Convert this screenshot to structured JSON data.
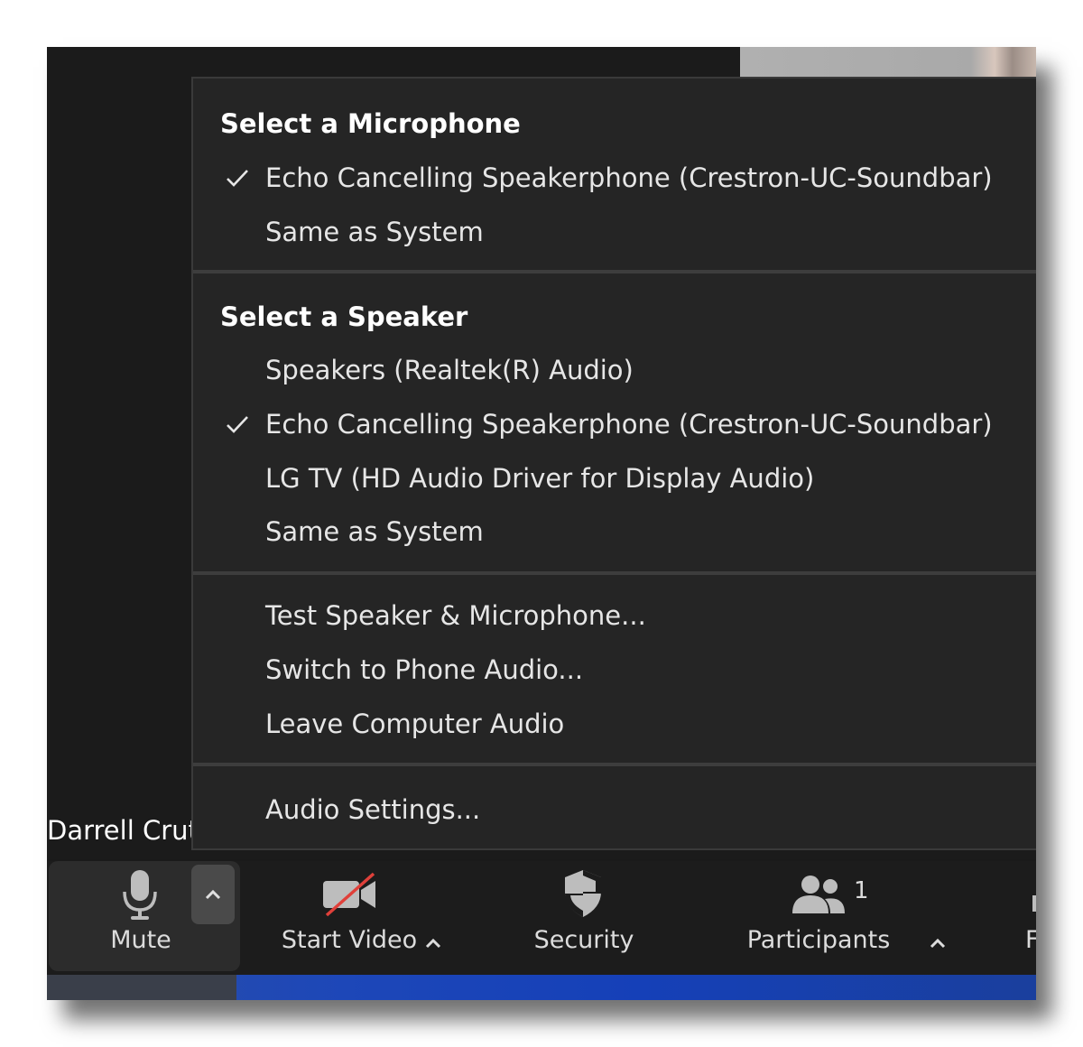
{
  "participant_name": "Darrell Crut",
  "audio_menu": {
    "microphone": {
      "heading": "Select a Microphone",
      "options": [
        {
          "label": "Echo Cancelling Speakerphone (Crestron-UC-Soundbar)",
          "checked": true
        },
        {
          "label": "Same as System",
          "checked": false
        }
      ]
    },
    "speaker": {
      "heading": "Select a Speaker",
      "options": [
        {
          "label": "Speakers (Realtek(R) Audio)",
          "checked": false
        },
        {
          "label": "Echo Cancelling Speakerphone (Crestron-UC-Soundbar)",
          "checked": true
        },
        {
          "label": "LG TV (HD Audio Driver for Display Audio)",
          "checked": false
        },
        {
          "label": "Same as System",
          "checked": false
        }
      ]
    },
    "actions": [
      "Test Speaker & Microphone...",
      "Switch to Phone Audio...",
      "Leave Computer Audio"
    ],
    "settings": "Audio Settings..."
  },
  "toolbar": {
    "mute": "Mute",
    "start_video": "Start Video",
    "security": "Security",
    "participants": "Participants",
    "participants_count": "1",
    "partial_next": "F"
  },
  "icons": {
    "check": "check-icon",
    "mic": "microphone-icon",
    "video": "video-off-icon",
    "security": "shield-icon",
    "participants": "people-icon",
    "caret": "chevron-up-icon"
  },
  "colors": {
    "menu_bg": "#252525",
    "toolbar_bg": "#1c1c1c",
    "video_off_slash": "#e0403a"
  }
}
